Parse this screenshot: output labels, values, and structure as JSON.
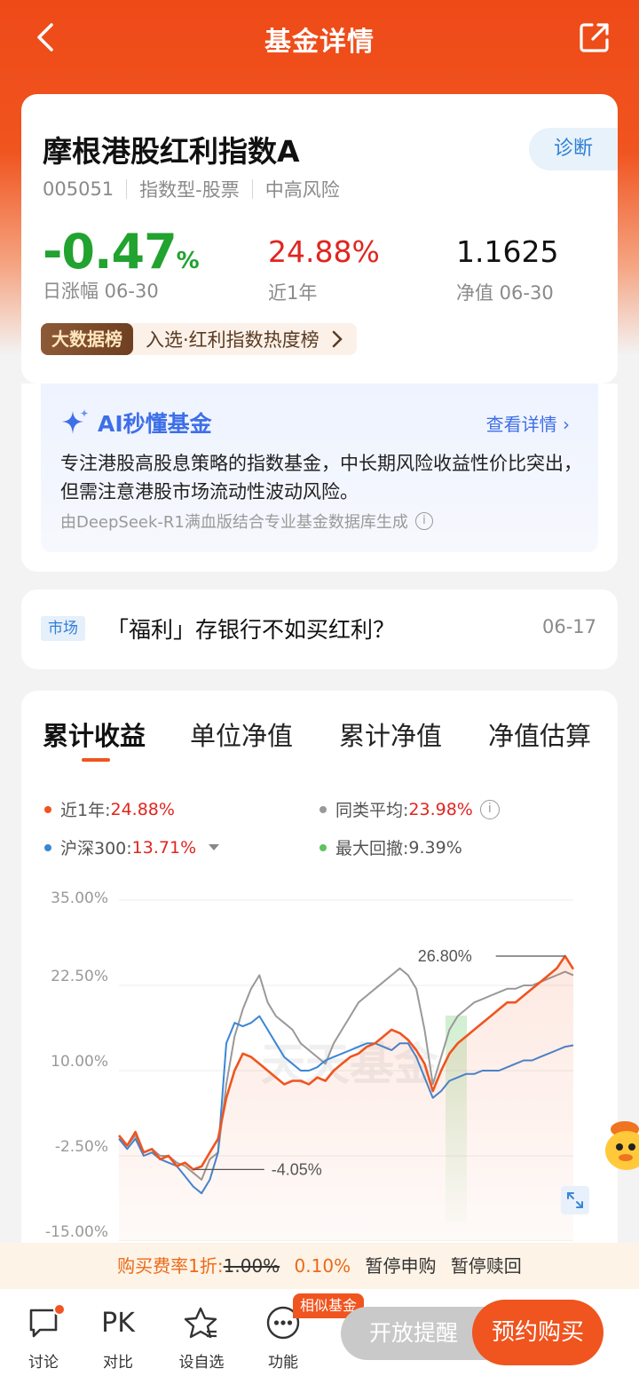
{
  "nav": {
    "title": "基金详情",
    "back_icon": "chevron-left-icon",
    "share_icon": "share-icon"
  },
  "fund": {
    "name": "摩根港股红利指数A",
    "code": "005051",
    "category": "指数型-股票",
    "risk": "中高风险",
    "diagnose_label": "诊断",
    "daily_change": {
      "value": "-0.47",
      "unit": "%",
      "label": "日涨幅 06-30",
      "color": "#22a22f"
    },
    "one_year": {
      "value": "24.88%",
      "label": "近1年",
      "color": "#e0251f"
    },
    "nav_value": {
      "value": "1.1625",
      "label": "净值 06-30"
    },
    "bigdata": {
      "badge": "大数据榜",
      "text": "入选·红利指数热度榜"
    }
  },
  "ai": {
    "title": "AI秒懂基金",
    "more": "查看详情 ›",
    "description": "专注港股高股息策略的指数基金，中长期风险收益性价比突出，但需注意港股市场流动性波动风险。",
    "note": "由DeepSeek-R1满血版结合专业基金数据库生成",
    "info_icon": "i"
  },
  "news": {
    "tag": "市场",
    "title": "「福利」存银行不如买红利？",
    "date": "06-17"
  },
  "chart_tabs": [
    "累计收益",
    "单位净值",
    "累计净值",
    "净值估算"
  ],
  "legend": {
    "fund": {
      "label": "近1年:",
      "value": "24.88%",
      "color": "#f0541f"
    },
    "peer": {
      "label": "同类平均:",
      "value": "23.98%",
      "color": "#999999"
    },
    "index": {
      "label": "沪深300:",
      "value": "13.71%",
      "color": "#3a86d6"
    },
    "drawdown": {
      "label": "最大回撤:",
      "value": "9.39%",
      "color": "#5cc45c"
    }
  },
  "chart_data": {
    "type": "line",
    "ylim": [
      -15,
      35
    ],
    "yticks": [
      "35.00%",
      "22.50%",
      "10.00%",
      "-2.50%",
      "-15.00%"
    ],
    "annotations": {
      "max": "26.80%",
      "min": "-4.05%"
    },
    "watermark": "天天基金",
    "series": [
      {
        "name": "近1年",
        "color": "#f0541f",
        "values": [
          0.5,
          -1.0,
          1.0,
          -2.0,
          -1.5,
          -3.0,
          -2.5,
          -4.0,
          -3.5,
          -4.5,
          -4.05,
          -2.0,
          0.0,
          6.0,
          10.0,
          12.5,
          12.0,
          11.0,
          10.0,
          9.0,
          8.0,
          8.5,
          8.5,
          8.0,
          9.0,
          8.5,
          10.0,
          11.0,
          12.0,
          12.5,
          13.5,
          14.0,
          15.0,
          16.0,
          15.5,
          14.5,
          13.0,
          11.0,
          7.0,
          10.0,
          12.5,
          14.0,
          15.0,
          16.0,
          17.0,
          18.0,
          19.0,
          20.0,
          20.0,
          21.0,
          22.0,
          23.0,
          24.0,
          25.0,
          26.8,
          24.88
        ]
      },
      {
        "name": "同类平均",
        "color": "#999999",
        "values": [
          0.0,
          -1.0,
          0.5,
          -2.0,
          -1.5,
          -2.5,
          -2.5,
          -3.5,
          -4.0,
          -5.0,
          -6.0,
          -3.0,
          -2.0,
          8.0,
          15.0,
          19.0,
          22.0,
          24.0,
          20.0,
          18.0,
          17.0,
          16.0,
          14.0,
          13.0,
          12.0,
          11.0,
          14.0,
          16.0,
          18.0,
          20.0,
          21.0,
          22.0,
          23.0,
          24.0,
          25.0,
          24.0,
          22.0,
          16.0,
          8.0,
          12.0,
          16.0,
          18.0,
          19.0,
          20.0,
          20.5,
          21.0,
          21.5,
          22.0,
          22.0,
          22.5,
          22.5,
          23.0,
          23.5,
          24.0,
          24.5,
          23.98
        ]
      },
      {
        "name": "沪深300",
        "color": "#3a86d6",
        "values": [
          0.0,
          -1.5,
          0.0,
          -2.5,
          -2.0,
          -3.0,
          -3.5,
          -4.0,
          -5.5,
          -7.0,
          -8.0,
          -6.0,
          -2.0,
          14.0,
          17.0,
          16.5,
          17.0,
          18.0,
          16.0,
          14.0,
          12.0,
          11.0,
          10.0,
          10.0,
          10.5,
          11.5,
          12.0,
          12.5,
          13.0,
          13.5,
          14.0,
          14.0,
          13.5,
          13.0,
          14.0,
          14.0,
          12.0,
          9.0,
          6.0,
          7.0,
          8.5,
          9.0,
          9.5,
          9.5,
          10.0,
          10.0,
          10.0,
          10.5,
          11.0,
          11.5,
          11.5,
          12.0,
          12.5,
          13.0,
          13.5,
          13.71
        ]
      }
    ]
  },
  "fee": {
    "prefix": "购买费率1折:",
    "original": "1.00%",
    "discount": "0.10%",
    "status1": "暂停申购",
    "status2": "暂停赎回"
  },
  "bottom": {
    "discuss": "讨论",
    "pk_icon": "PK",
    "pk": "对比",
    "watchlist": "设自选",
    "more": "功能",
    "similar": "相似基金",
    "remind": "开放提醒",
    "buy": "预约购买"
  }
}
